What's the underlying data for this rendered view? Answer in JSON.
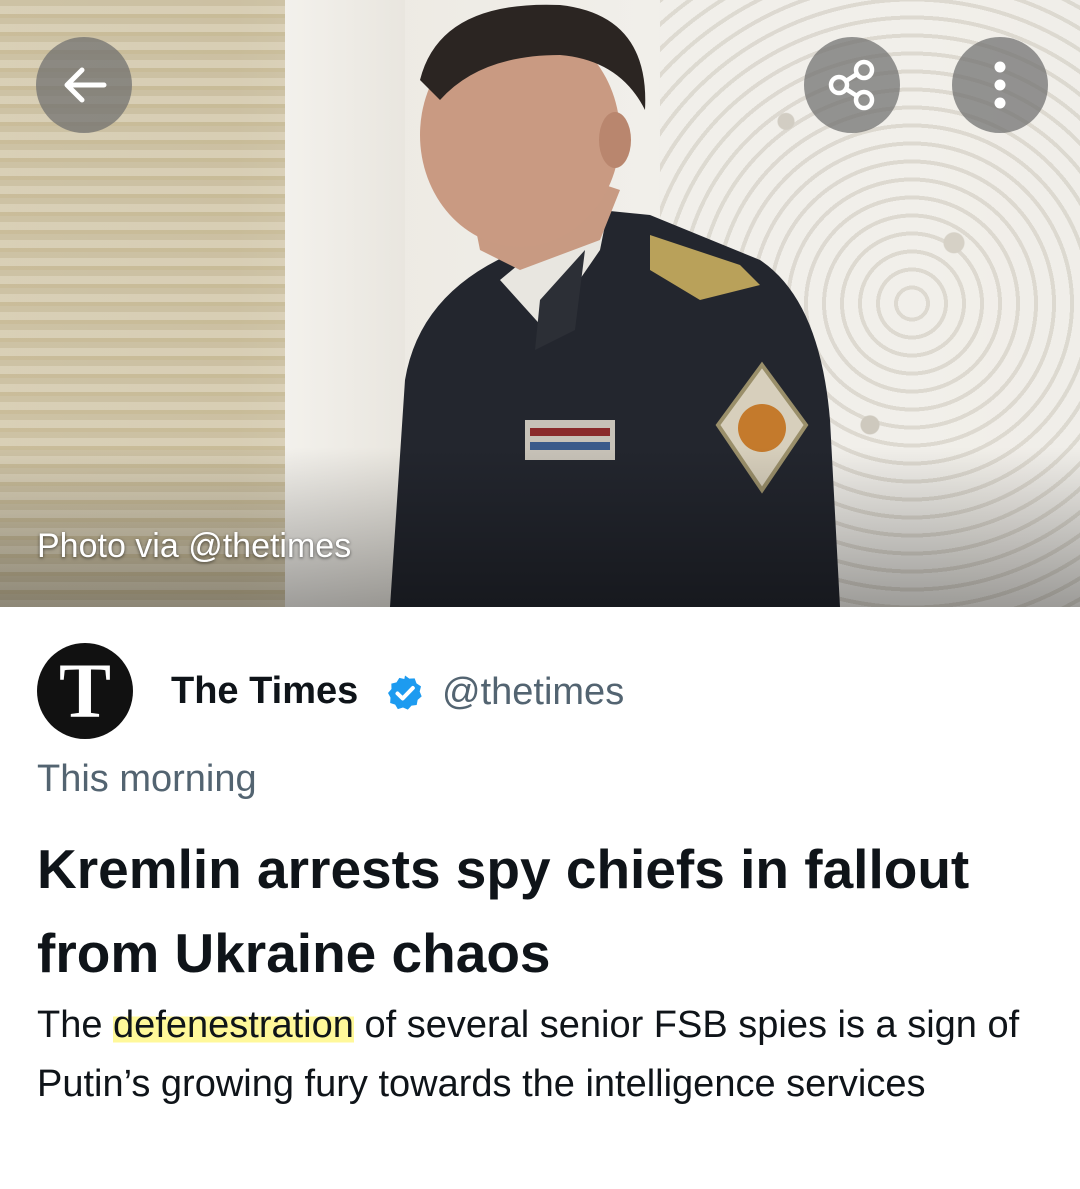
{
  "hero": {
    "photo_credit": "Photo via @thetimes",
    "back_icon": "arrow-left-icon",
    "share_icon": "share-icon",
    "more_icon": "more-vertical-icon"
  },
  "author": {
    "avatar_letter": "T",
    "name": "The Times",
    "handle": "@thetimes",
    "verified": true,
    "verified_color": "#1d9bf0"
  },
  "timestamp": "This morning",
  "headline": "Kremlin arrests spy chiefs in fallout from Ukraine chaos",
  "description": {
    "before": "The ",
    "highlighted": "defenestration",
    "after": " of several senior FSB spies is a sign of Putin’s growing fury towards the intelligence services",
    "highlight_color": "#fff678"
  }
}
